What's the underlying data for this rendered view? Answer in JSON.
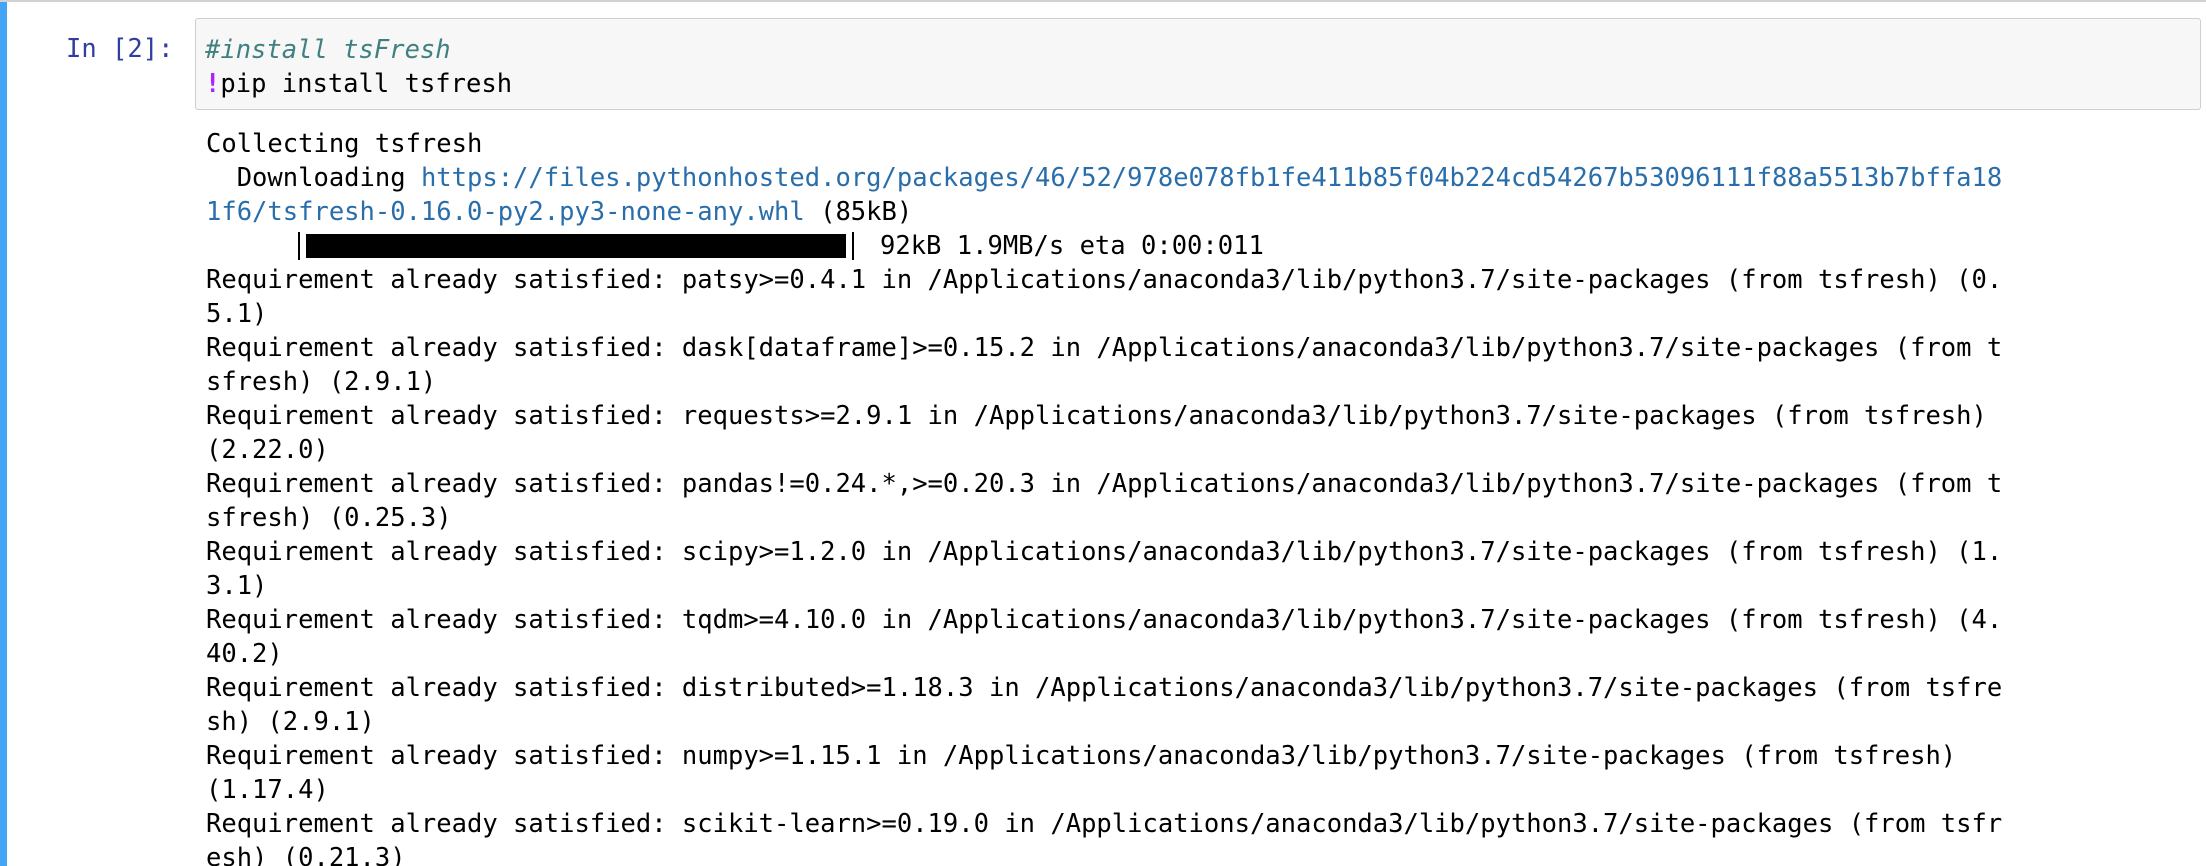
{
  "cell": {
    "prompt": "In [2]:",
    "code": {
      "comment": "#install tsFresh",
      "bang": "!",
      "command": "pip install tsfresh"
    }
  },
  "output": {
    "collecting": "Collecting tsfresh",
    "downloading_prefix": "  Downloading ",
    "download_url_line1": "https://files.pythonhosted.org/packages/46/52/978e078fb1fe411b85f04b224cd54267b53096111f88a5513b7bffa18",
    "download_url_line2": "1f6/tsfresh-0.16.0-py2.py3-none-any.whl",
    "download_size": " (85kB)",
    "progress": {
      "fraction": 1.0,
      "text": "92kB 1.9MB/s eta 0:00:011"
    },
    "lines": [
      "Requirement already satisfied: patsy>=0.4.1 in /Applications/anaconda3/lib/python3.7/site-packages (from tsfresh) (0.",
      "5.1)",
      "Requirement already satisfied: dask[dataframe]>=0.15.2 in /Applications/anaconda3/lib/python3.7/site-packages (from t",
      "sfresh) (2.9.1)",
      "Requirement already satisfied: requests>=2.9.1 in /Applications/anaconda3/lib/python3.7/site-packages (from tsfresh)",
      "(2.22.0)",
      "Requirement already satisfied: pandas!=0.24.*,>=0.20.3 in /Applications/anaconda3/lib/python3.7/site-packages (from t",
      "sfresh) (0.25.3)",
      "Requirement already satisfied: scipy>=1.2.0 in /Applications/anaconda3/lib/python3.7/site-packages (from tsfresh) (1.",
      "3.1)",
      "Requirement already satisfied: tqdm>=4.10.0 in /Applications/anaconda3/lib/python3.7/site-packages (from tsfresh) (4.",
      "40.2)",
      "Requirement already satisfied: distributed>=1.18.3 in /Applications/anaconda3/lib/python3.7/site-packages (from tsfre",
      "sh) (2.9.1)",
      "Requirement already satisfied: numpy>=1.15.1 in /Applications/anaconda3/lib/python3.7/site-packages (from tsfresh)",
      "(1.17.4)",
      "Requirement already satisfied: scikit-learn>=0.19.0 in /Applications/anaconda3/lib/python3.7/site-packages (from tsfr",
      "esh) (0.21.3)"
    ]
  },
  "colors": {
    "prompt": "#303f9f",
    "comment": "#408080",
    "bang": "#aa22ff",
    "link": "#296eaa",
    "selected_cell_rail": "#42a5f5"
  }
}
